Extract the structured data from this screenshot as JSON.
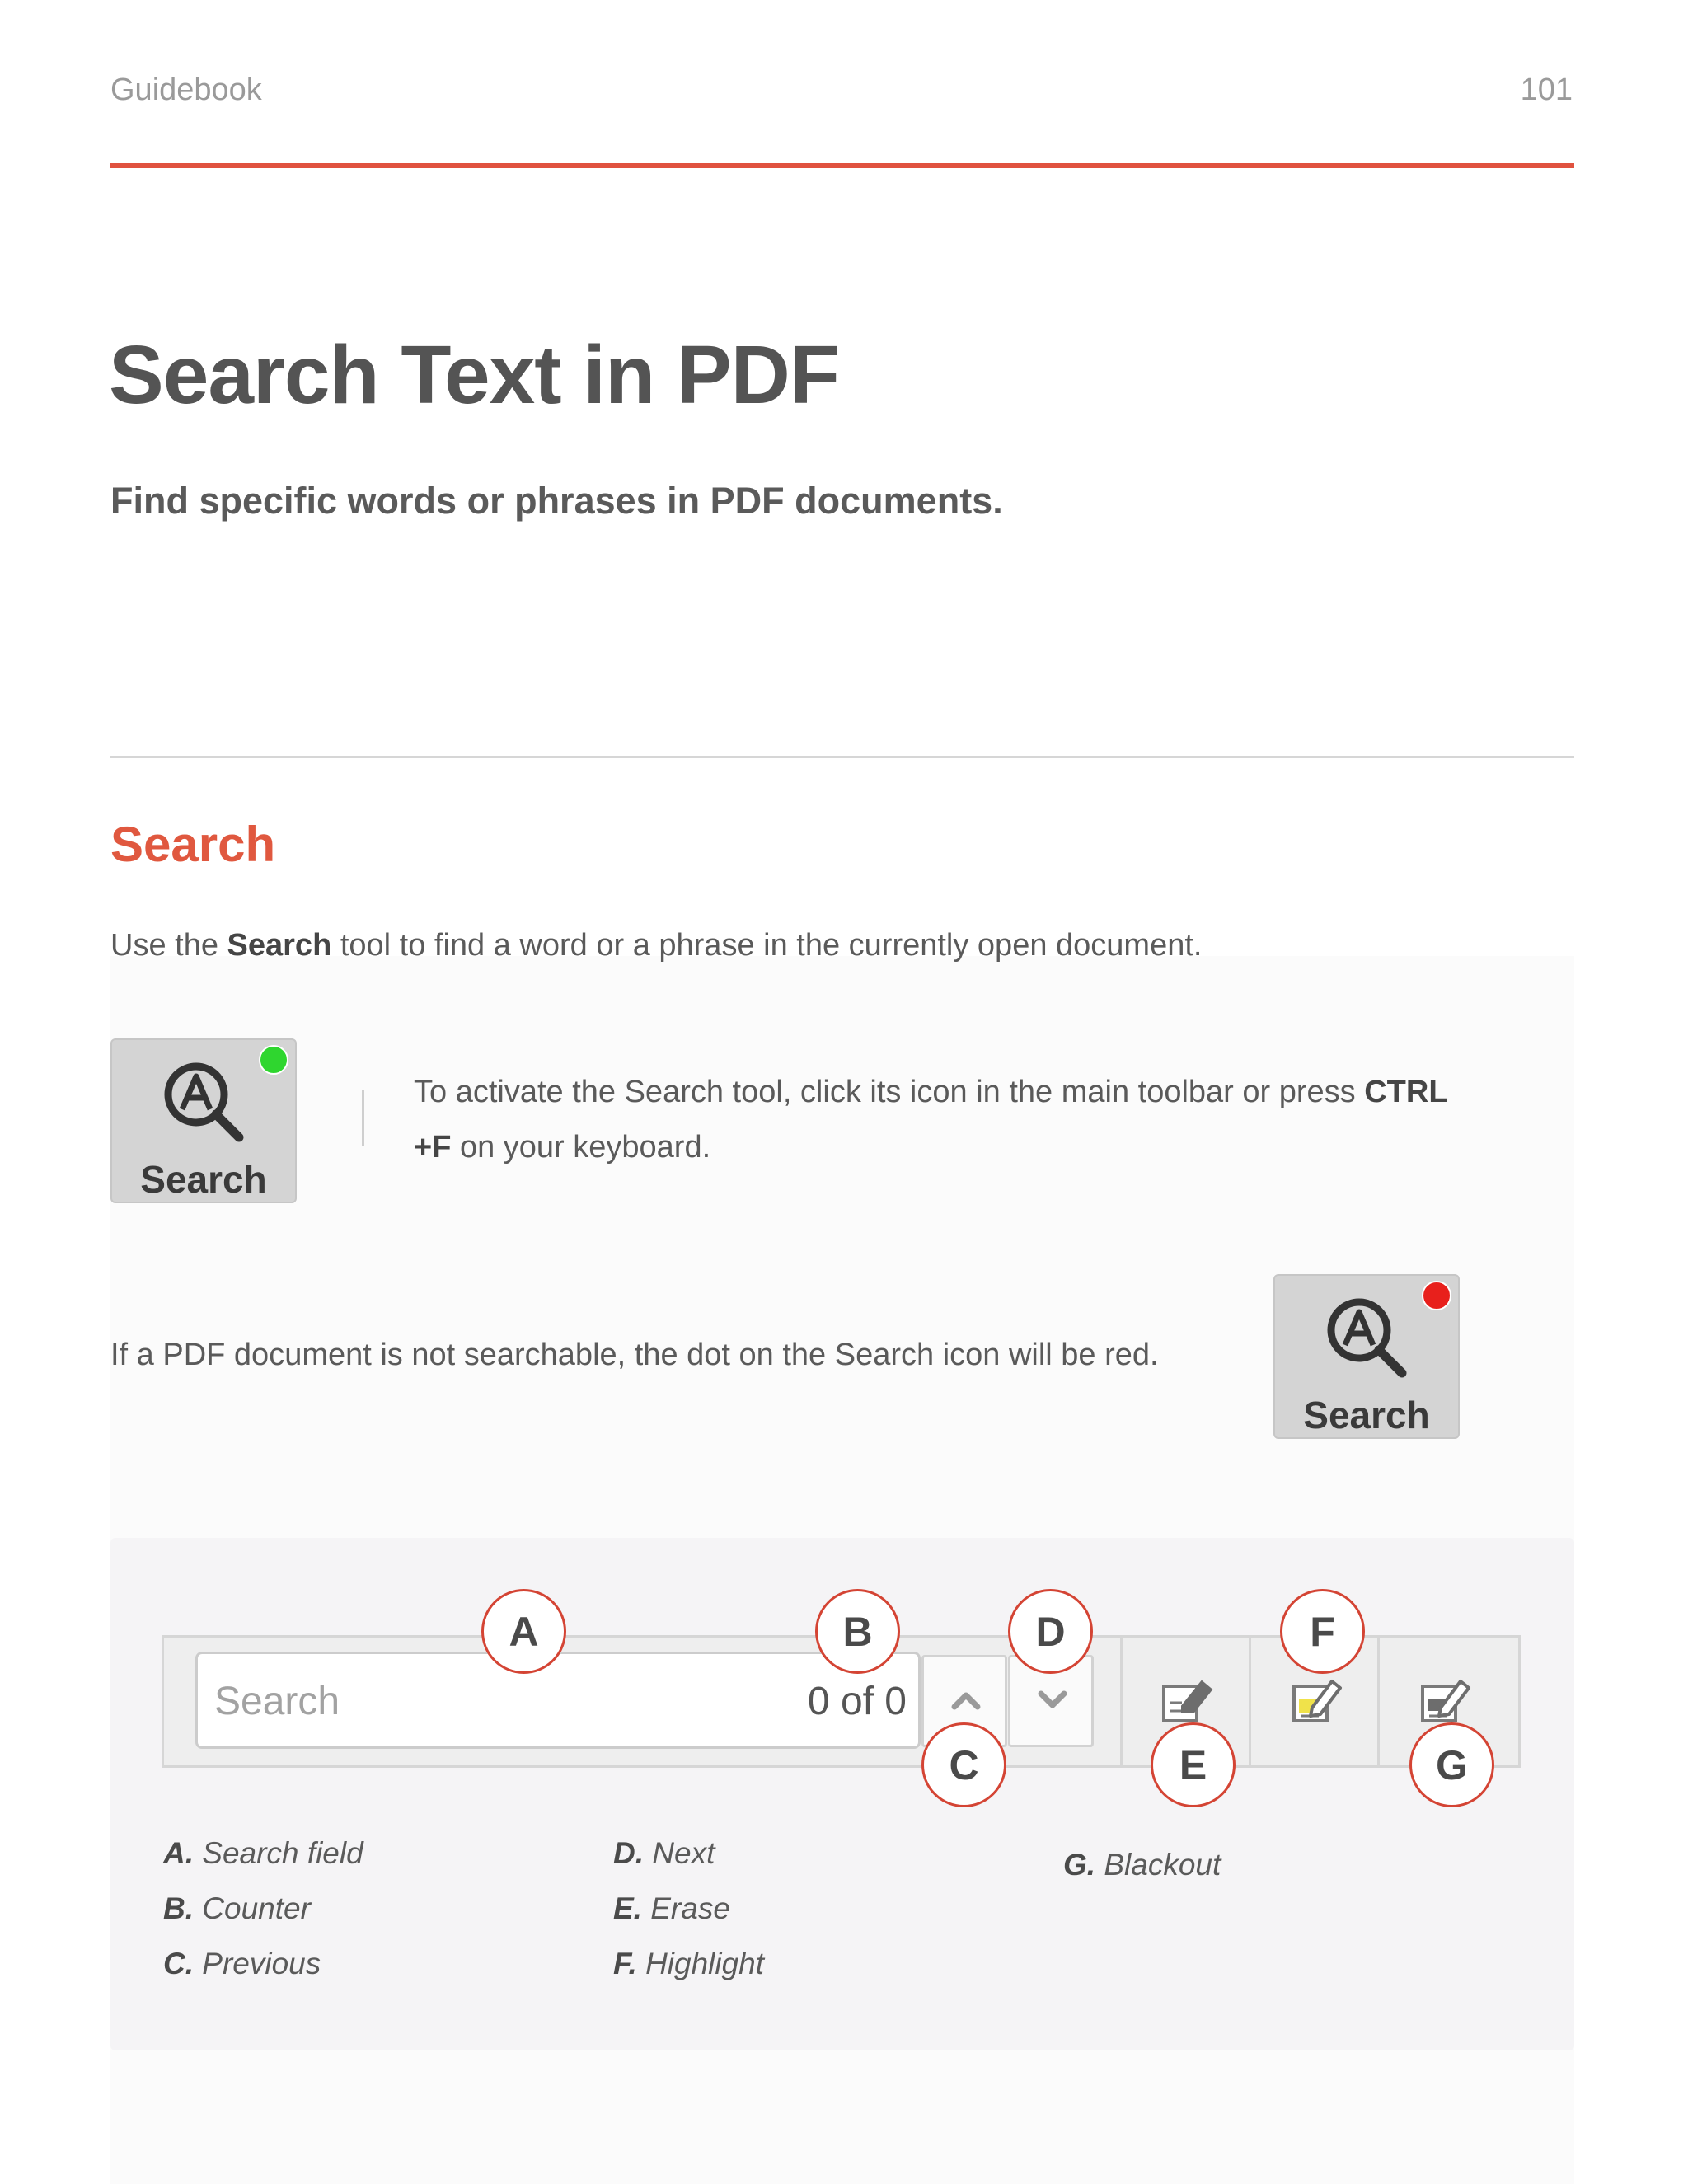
{
  "header": {
    "running_title": "Guidebook",
    "page_number": "101"
  },
  "page": {
    "title": "Search Text in PDF",
    "subtitle": "Find specific words or phrases in PDF documents."
  },
  "section": {
    "heading": "Search",
    "intro_pre": "Use the ",
    "intro_bold": "Search",
    "intro_post": " tool to find a word or a phrase in the currently open document.",
    "activate_pre": "To activate the Search tool, click its icon in the main toolbar or press ",
    "activate_bold1": "CTRL",
    "activate_bold2": "+F",
    "activate_post": " on your keyboard.",
    "nonsearchable": "If a PDF document is not searchable, the dot on the Search icon will be red."
  },
  "tool_icon": {
    "label": "Search",
    "searchable_dot_color": "#2fd62f",
    "not_searchable_dot_color": "#e8201c"
  },
  "toolbar": {
    "search_placeholder": "Search",
    "counter": "0 of 0",
    "icons": {
      "previous": "chevron-up-icon",
      "next": "chevron-down-icon",
      "erase": "erase-icon",
      "highlight": "highlight-icon",
      "blackout": "blackout-icon"
    }
  },
  "callouts": {
    "a": "A",
    "b": "B",
    "c": "C",
    "d": "D",
    "e": "E",
    "f": "F",
    "g": "G"
  },
  "legend": [
    {
      "letter": "A.",
      "text": "Search field"
    },
    {
      "letter": "B.",
      "text": "Counter"
    },
    {
      "letter": "C.",
      "text": "Previous"
    },
    {
      "letter": "D.",
      "text": "Next"
    },
    {
      "letter": "E.",
      "text": "Erase"
    },
    {
      "letter": "F.",
      "text": "Highlight"
    },
    {
      "letter": "G.",
      "text": "Blackout"
    }
  ],
  "colors": {
    "accent": "#e0523f",
    "callout_border": "#d44434"
  }
}
